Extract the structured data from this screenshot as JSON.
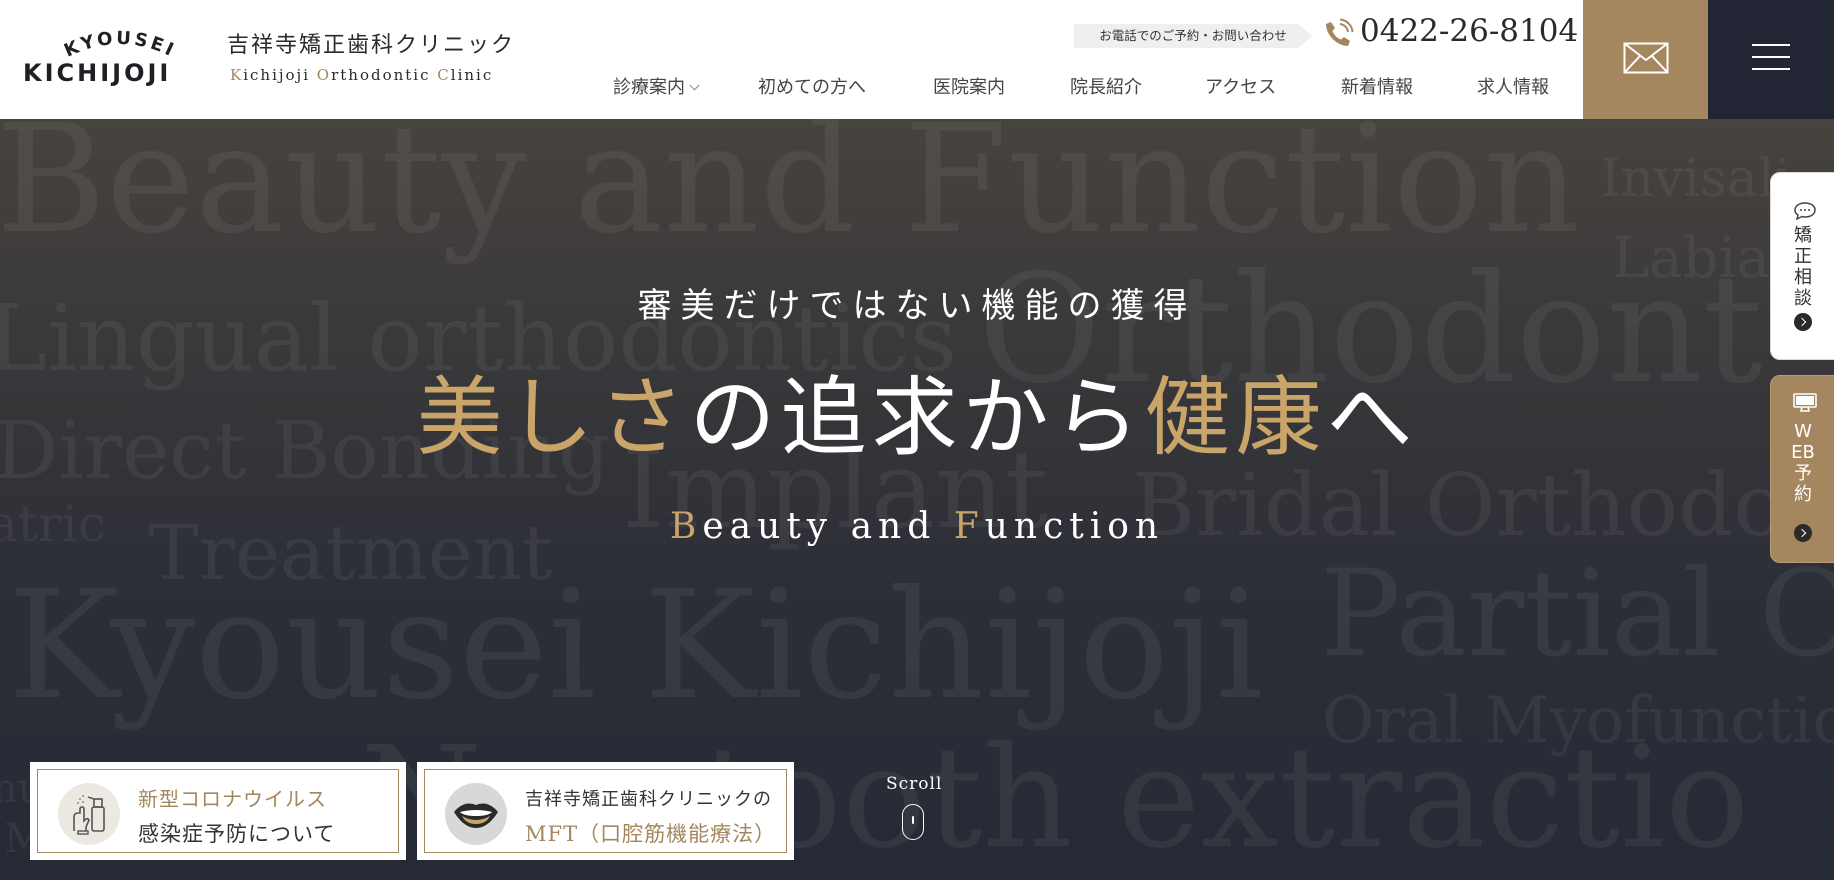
{
  "header": {
    "logo_arc": "KYOUSEI",
    "logo_main": "KICHIJOJI",
    "clinic_name_jp": "吉祥寺矯正歯科クリニック",
    "clinic_name_en_parts": [
      {
        "t": "K",
        "g": true
      },
      {
        "t": "ichijoji ",
        "g": false
      },
      {
        "t": "O",
        "g": true
      },
      {
        "t": "rthodontic ",
        "g": false
      },
      {
        "t": "C",
        "g": true
      },
      {
        "t": "linic",
        "g": false
      }
    ],
    "phone_label": "お電話でのご予約・お問い合わせ",
    "phone_number": "0422-26-8104",
    "nav": [
      {
        "label": "診療案内",
        "dropdown": true
      },
      {
        "label": "初めての方へ"
      },
      {
        "label": "医院案内"
      },
      {
        "label": "院長紹介"
      },
      {
        "label": "アクセス"
      },
      {
        "label": "新着情報"
      },
      {
        "label": "求人情報"
      }
    ],
    "icons": {
      "phone": "phone-icon",
      "mail": "mail-icon",
      "menu": "hamburger-menu-icon"
    }
  },
  "hero": {
    "background_words": [
      "Beauty and Function",
      "Invisali",
      "Labia",
      "Lingual orthodontics",
      "Orthodont",
      "Direct Bonding",
      "Implant",
      "atric",
      "Treatment",
      "Bridal Orthodo",
      "Kyousei Kichijoji",
      "Partial Or",
      "Oral Myofunctiona",
      "Non tooth extractio",
      "nu",
      "M"
    ],
    "subtitle": "審美だけではない機能の獲得",
    "headline": {
      "g1": "美しさ",
      "w1": "の追求から",
      "g2": "健康",
      "w2": "へ"
    },
    "tagline": {
      "g1": "B",
      "w1": "eauty and ",
      "g2": "F",
      "w2": "unction"
    },
    "scroll_label": "Scroll"
  },
  "banners": [
    {
      "line1": "新型コロナウイルス",
      "line2": "感染症予防について",
      "icon": "spray-sanitizer-icon"
    },
    {
      "line1": "吉祥寺矯正歯科クリニックの",
      "line2": "MFT（口腔筋機能療法）",
      "icon": "mouth-lips-icon"
    }
  ],
  "side_tabs": {
    "consult": {
      "label": "矯正相談",
      "icon": "chat-bubble-icon"
    },
    "web": {
      "label": "WEB予約",
      "icon": "computer-monitor-icon"
    }
  },
  "colors": {
    "gold": "#a4865f",
    "hero_gold": "#c9a56a",
    "navy": "#222634"
  }
}
